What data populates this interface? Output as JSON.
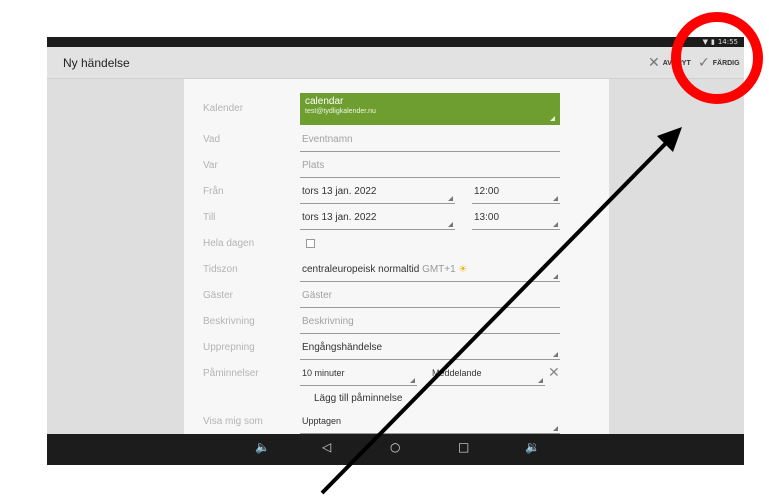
{
  "status_bar": {
    "time": "14:55"
  },
  "action_bar": {
    "title": "Ny händelse",
    "cancel_label": "AVBRYT",
    "done_label": "FÄRDIG"
  },
  "form": {
    "calendar": {
      "label": "Kalender",
      "name": "calendar",
      "account": "test@tydligkalender.nu"
    },
    "what": {
      "label": "Vad",
      "placeholder": "Eventnamn"
    },
    "where": {
      "label": "Var",
      "placeholder": "Plats"
    },
    "from": {
      "label": "Från",
      "date": "tors 13 jan. 2022",
      "time": "12:00"
    },
    "to": {
      "label": "Till",
      "date": "tors 13 jan. 2022",
      "time": "13:00"
    },
    "all_day": {
      "label": "Hela dagen",
      "checked": false
    },
    "timezone": {
      "label": "Tidszon",
      "value": "centraleuropeisk normaltid",
      "offset": "GMT+1"
    },
    "guests": {
      "label": "Gäster",
      "placeholder": "Gäster"
    },
    "description": {
      "label": "Beskrivning",
      "placeholder": "Beskrivning"
    },
    "repeat": {
      "label": "Upprepning",
      "value": "Engångshändelse"
    },
    "reminders": {
      "label": "Påminnelser",
      "time": "10 minuter",
      "method": "Meddelande",
      "add_label": "Lägg till påminnelse"
    },
    "show_as": {
      "label": "Visa mig som",
      "value": "Upptagen"
    }
  },
  "icons": {
    "wifi": "wifi-icon",
    "battery": "battery-icon",
    "cancel": "close-icon",
    "done": "check-icon",
    "volume_down": "volume-down-icon",
    "back": "back-icon",
    "home": "home-icon",
    "recents": "recents-icon",
    "volume_up": "volume-up-icon"
  },
  "colors": {
    "calendar_green": "#6e9e2f",
    "annotation_red": "#ff0000",
    "annotation_arrow": "#000000"
  }
}
